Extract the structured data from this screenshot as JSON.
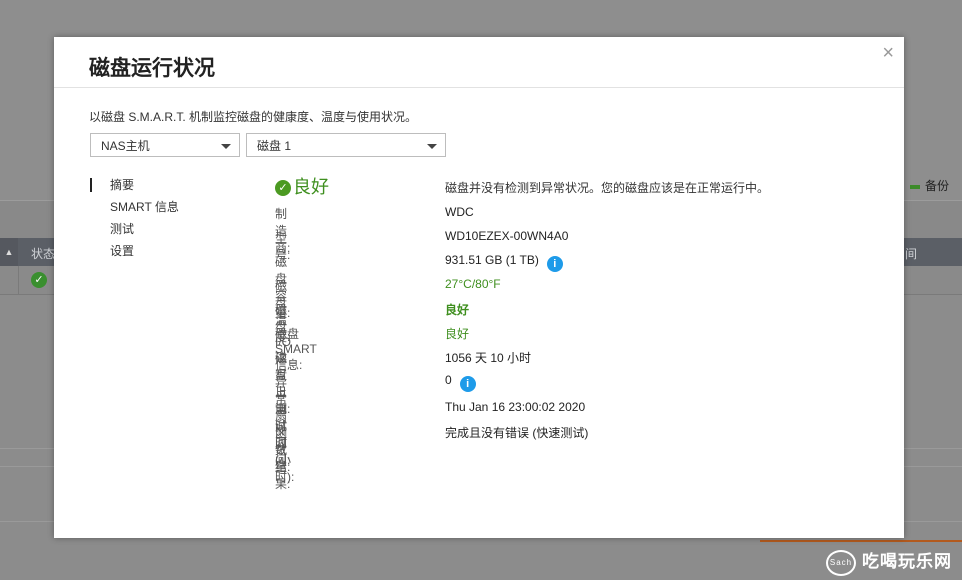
{
  "background": {
    "legend_label": "备份",
    "table_header_col1": "状态",
    "table_header_col2": "间",
    "watermark": "吃喝玩乐网",
    "watermark_logo": "Sach"
  },
  "dialog": {
    "title": "磁盘运行状况",
    "close_symbol": "×",
    "description": "以磁盘 S.M.A.R.T. 机制监控磁盘的健康度、温度与使用状况。",
    "host_select": "NAS主机",
    "disk_select": "磁盘 1",
    "nav": [
      "摘要",
      "SMART 信息",
      "测试",
      "设置"
    ],
    "status": {
      "label": "良好",
      "message": "磁盘并没有检测到异常状况。您的磁盘应该是在正常运行中。",
      "color": "#3f8f1f"
    },
    "details": [
      {
        "label": "制造商:",
        "value": "WDC"
      },
      {
        "label": "型号:",
        "value": "WD10EZEX-00WN4A0"
      },
      {
        "label": "磁盘容量:",
        "value": "931.51 GB (1 TB)"
      },
      {
        "label": "磁盘温度:",
        "value": "27°C/80°F"
      },
      {
        "label": "磁盘I/O读写日志:",
        "value": "良好"
      },
      {
        "label": "磁盘SMART信息:",
        "value": "良好"
      },
      {
        "label": "磁盘上电时间(小时):",
        "value": "1056 天 10 小时"
      },
      {
        "label": "异常扇区数量:",
        "value": "0"
      },
      {
        "label": "测试时间:",
        "value": "Thu Jan 16 23:00:02 2020"
      },
      {
        "label": "测试结果:",
        "value": "完成且没有错误 (快速测试)"
      }
    ]
  }
}
